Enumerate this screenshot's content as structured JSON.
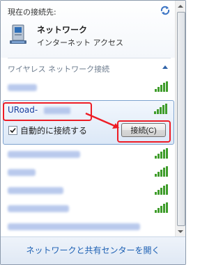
{
  "current": {
    "label": "現在の接続先:",
    "network_name": "ネットワーク",
    "network_status": "インターネット アクセス",
    "icon": "network-computer-icon"
  },
  "wireless_section": {
    "title": "ワイヤレス ネットワーク接続"
  },
  "selected": {
    "name": "URoad-",
    "auto_connect_label": "自動的に接続する",
    "auto_connect_checked": true,
    "connect_button": "接続(C)"
  },
  "footer": {
    "link": "ネットワークと共有センターを開く"
  },
  "colors": {
    "highlight": "#ee1c25",
    "link": "#1b5fb3",
    "signal": "#3f9d2b"
  }
}
